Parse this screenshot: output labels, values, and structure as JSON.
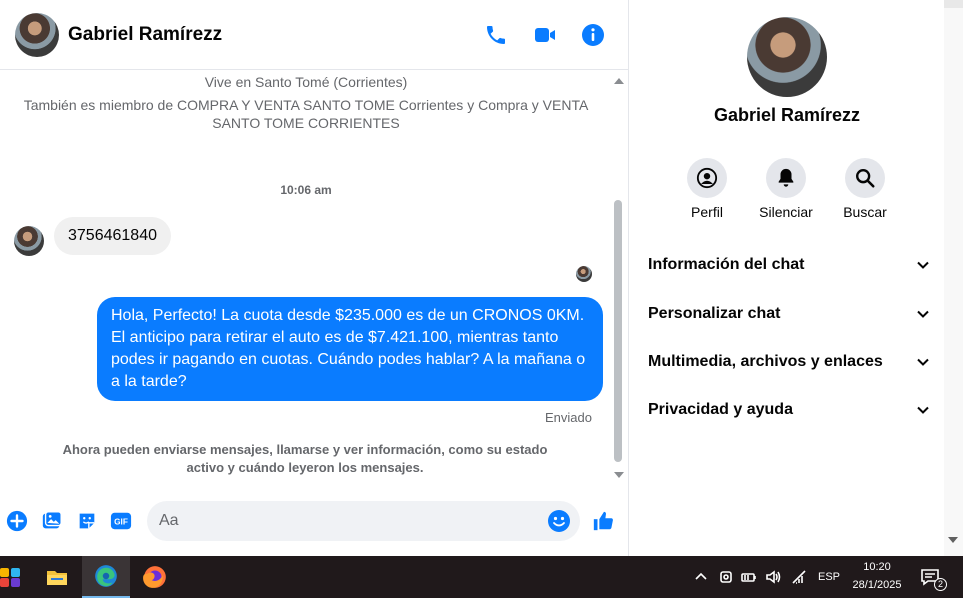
{
  "chat": {
    "contact_name": "Gabriel Ramírezz",
    "header_icons": [
      "phone-icon",
      "video-camera-icon",
      "info-icon"
    ],
    "info_lines": [
      "Vive en Santo Tomé (Corrientes)",
      "También es miembro de COMPRA Y VENTA SANTO TOME Corrientes y Compra y VENTA",
      "SANTO TOME CORRIENTES"
    ],
    "timestamp": "10:06 am",
    "incoming_message": "3756461840",
    "outgoing_message": "Hola, Perfecto! La cuota desde $235.000 es de un CRONOS 0KM. El anticipo para retirar el auto es de $7.421.100, mientras tanto podes ir pagando en cuotas. Cuándo podes hablar? A la mañana o a la tarde?",
    "sent_status": "Enviado",
    "notice_line1": "Ahora pueden enviarse mensajes, llamarse y ver información, como su estado",
    "notice_line2": "activo y cuándo leyeron los mensajes."
  },
  "composer": {
    "placeholder": "Aa",
    "gif_label": "GIF",
    "icons": [
      "plus-icon",
      "image-icon",
      "sticker-icon",
      "gif-icon",
      "emoji-icon",
      "thumbs-up-icon"
    ]
  },
  "panel": {
    "name": "Gabriel Ramírezz",
    "actions": [
      {
        "label": "Perfil",
        "icon": "profile-icon"
      },
      {
        "label": "Silenciar",
        "icon": "bell-icon"
      },
      {
        "label": "Buscar",
        "icon": "search-icon"
      }
    ],
    "sections": [
      {
        "label": "Información del chat"
      },
      {
        "label": "Personalizar chat"
      },
      {
        "label": "Multimedia, archivos y enlaces"
      },
      {
        "label": "Privacidad y ayuda"
      }
    ]
  },
  "taskbar": {
    "apps": [
      "widgets-icon",
      "file-explorer-icon",
      "edge-icon",
      "firefox-icon"
    ],
    "language": "ESP",
    "time": "10:20",
    "date": "28/1/2025",
    "notification_count": "2"
  },
  "colors": {
    "accent": "#0a7cff",
    "incoming_bubble": "#f0f0f0",
    "taskbar": "#20191b"
  }
}
